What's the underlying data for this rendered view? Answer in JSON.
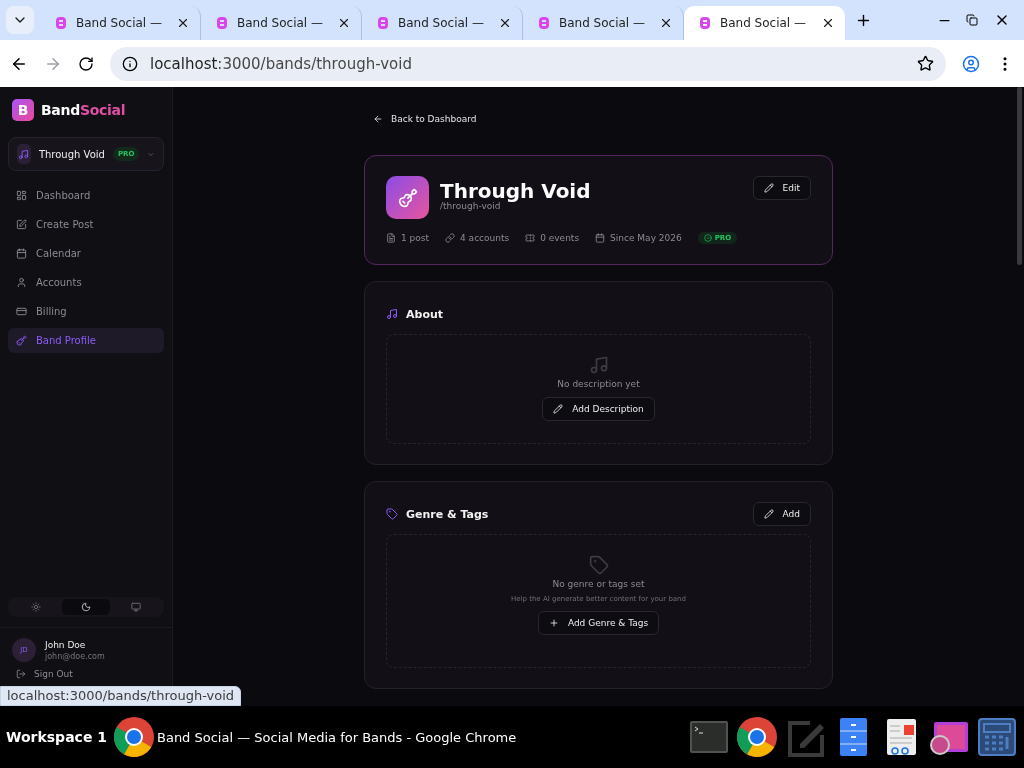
{
  "browser": {
    "tabs": [
      {
        "title": "Band Social —",
        "selected": false
      },
      {
        "title": "Band Social —",
        "selected": false
      },
      {
        "title": "Band Social —",
        "selected": false
      },
      {
        "title": "Band Social —",
        "selected": false
      },
      {
        "title": "Band Social —",
        "selected": true
      }
    ],
    "address": {
      "host": "localhost",
      "path": ":3000/bands/through-void"
    }
  },
  "sidebar": {
    "brand": {
      "logo_letter": "B",
      "name_first": "Band",
      "name_second": "Social"
    },
    "band_switcher": {
      "name": "Through Void",
      "badge": "PRO"
    },
    "nav": [
      {
        "label": "Dashboard",
        "kind": "dashboard",
        "selected": false
      },
      {
        "label": "Create Post",
        "kind": "compose",
        "selected": false
      },
      {
        "label": "Calendar",
        "kind": "calendar",
        "selected": false
      },
      {
        "label": "Accounts",
        "kind": "user",
        "selected": false
      },
      {
        "label": "Billing",
        "kind": "card",
        "selected": false
      },
      {
        "label": "Band Profile",
        "kind": "guitar",
        "selected": true
      }
    ],
    "theme_options": [
      {
        "kind": "light",
        "selected": false
      },
      {
        "kind": "dark",
        "selected": true
      },
      {
        "kind": "system",
        "selected": false
      }
    ],
    "user": {
      "initials": "JD",
      "name": "John Doe",
      "email": "john@doe.com"
    },
    "sign_out": "Sign Out"
  },
  "main": {
    "back_link": "Back to Dashboard",
    "profile": {
      "name": "Through Void",
      "slug": "/through-void",
      "edit_button": "Edit",
      "stats": [
        {
          "kind": "posts",
          "text": "1 post"
        },
        {
          "kind": "accounts",
          "text": "4 accounts"
        },
        {
          "kind": "events",
          "text": "0 events"
        },
        {
          "kind": "since",
          "text": "Since May 2026"
        }
      ],
      "plan_badge": "PRO"
    },
    "about": {
      "title": "About",
      "empty_text": "No description yet",
      "button": "Add Description"
    },
    "genre": {
      "title": "Genre & Tags",
      "add_button": "Add",
      "empty_title": "No genre or tags set",
      "empty_hint": "Help the AI generate better content for your band",
      "button": "Add Genre & Tags"
    }
  },
  "status_url": "localhost:3000/bands/through-void",
  "taskbar": {
    "workspace": "Workspace 1",
    "window_title": "Band Social — Social Media for Bands - Google Chrome",
    "apps": [
      {
        "kind": "terminal"
      },
      {
        "kind": "browser"
      },
      {
        "kind": "editor"
      },
      {
        "kind": "files"
      },
      {
        "kind": "viewer"
      },
      {
        "kind": "image"
      },
      {
        "kind": "calculator"
      }
    ]
  }
}
